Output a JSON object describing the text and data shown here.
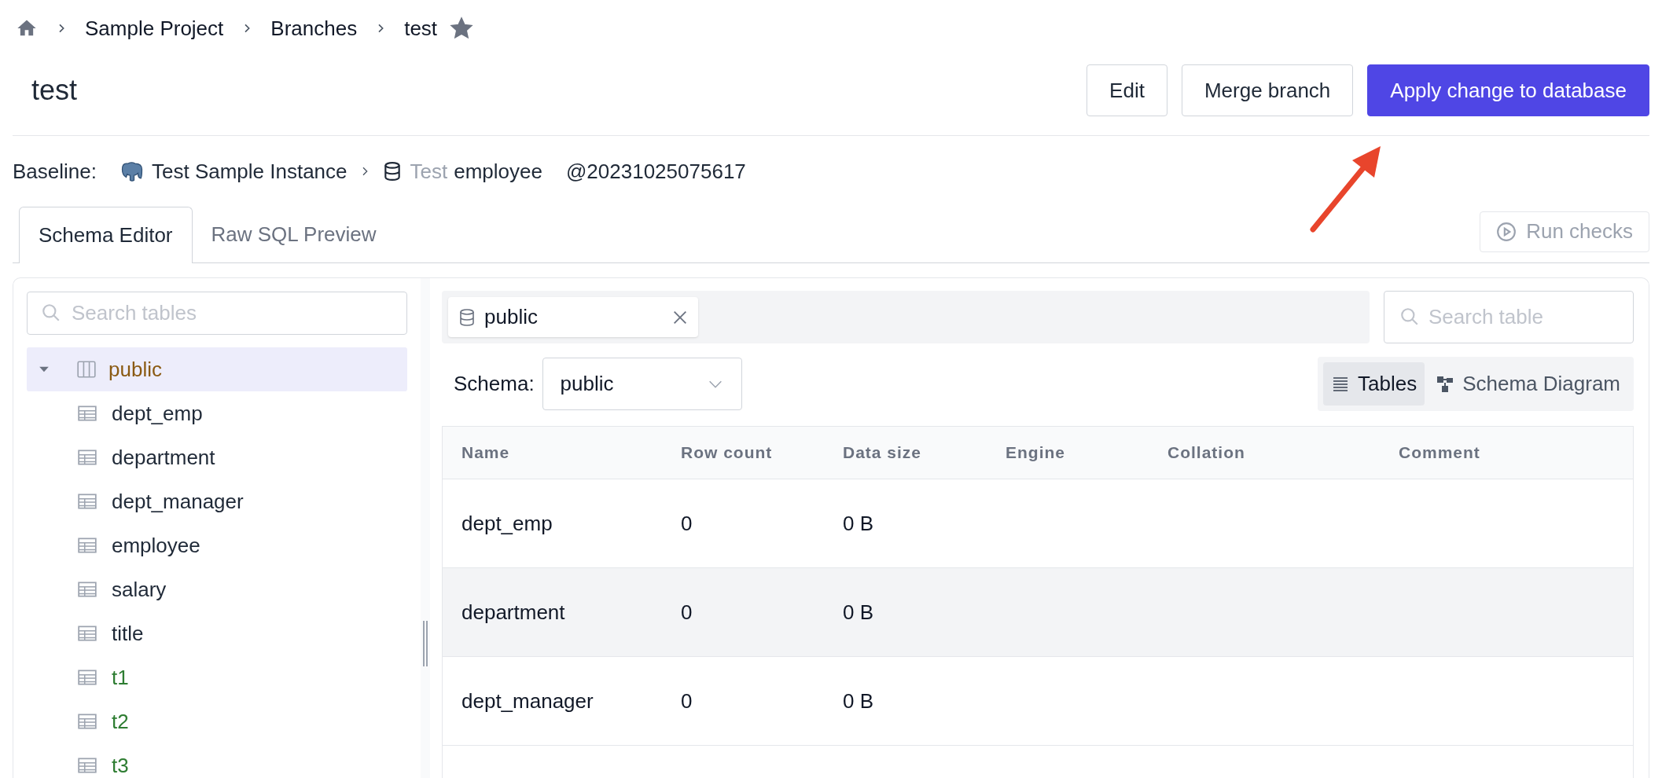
{
  "breadcrumb": {
    "items": [
      {
        "label": "Sample Project"
      },
      {
        "label": "Branches"
      },
      {
        "label": "test"
      }
    ],
    "starred": true
  },
  "title": "test",
  "actions": [
    {
      "label": "Edit",
      "kind": "default"
    },
    {
      "label": "Merge branch",
      "kind": "default"
    },
    {
      "label": "Apply change to database",
      "kind": "primary"
    }
  ],
  "baseline": {
    "label": "Baseline:",
    "instance": "Test Sample Instance",
    "environment": "Test",
    "database": "employee",
    "version": "@20231025075617"
  },
  "tabs": [
    {
      "label": "Schema Editor",
      "selected": true
    },
    {
      "label": "Raw SQL Preview",
      "selected": false
    }
  ],
  "run_checks": {
    "label": "Run checks",
    "disabled": true
  },
  "sidebar": {
    "search": {
      "placeholder": "Search tables"
    },
    "tree": [
      {
        "label": "public",
        "kind": "schema",
        "expanded": true,
        "selected": true,
        "children": [
          {
            "label": "dept_emp",
            "kind": "table",
            "added": false
          },
          {
            "label": "department",
            "kind": "table",
            "added": false
          },
          {
            "label": "dept_manager",
            "kind": "table",
            "added": false
          },
          {
            "label": "employee",
            "kind": "table",
            "added": false
          },
          {
            "label": "salary",
            "kind": "table",
            "added": false
          },
          {
            "label": "title",
            "kind": "table",
            "added": false
          },
          {
            "label": "t1",
            "kind": "table",
            "added": true
          },
          {
            "label": "t2",
            "kind": "table",
            "added": true
          },
          {
            "label": "t3",
            "kind": "table",
            "added": true
          }
        ]
      }
    ]
  },
  "editor": {
    "open_tabs": [
      {
        "label": "public"
      }
    ],
    "search": {
      "placeholder": "Search table"
    },
    "schema": {
      "label": "Schema:",
      "value": "public"
    },
    "views": [
      {
        "label": "Tables",
        "kind": "list",
        "selected": true
      },
      {
        "label": "Schema Diagram",
        "kind": "diagram",
        "selected": false
      }
    ],
    "table": {
      "columns": [
        "Name",
        "Row count",
        "Data size",
        "Engine",
        "Collation",
        "Comment"
      ],
      "rows": [
        {
          "cells": [
            "dept_emp",
            "0",
            "0 B"
          ],
          "hovered": false
        },
        {
          "cells": [
            "department",
            "0",
            "0 B"
          ],
          "hovered": true
        },
        {
          "cells": [
            "dept_manager",
            "0",
            "0 B"
          ],
          "hovered": false
        }
      ]
    }
  }
}
